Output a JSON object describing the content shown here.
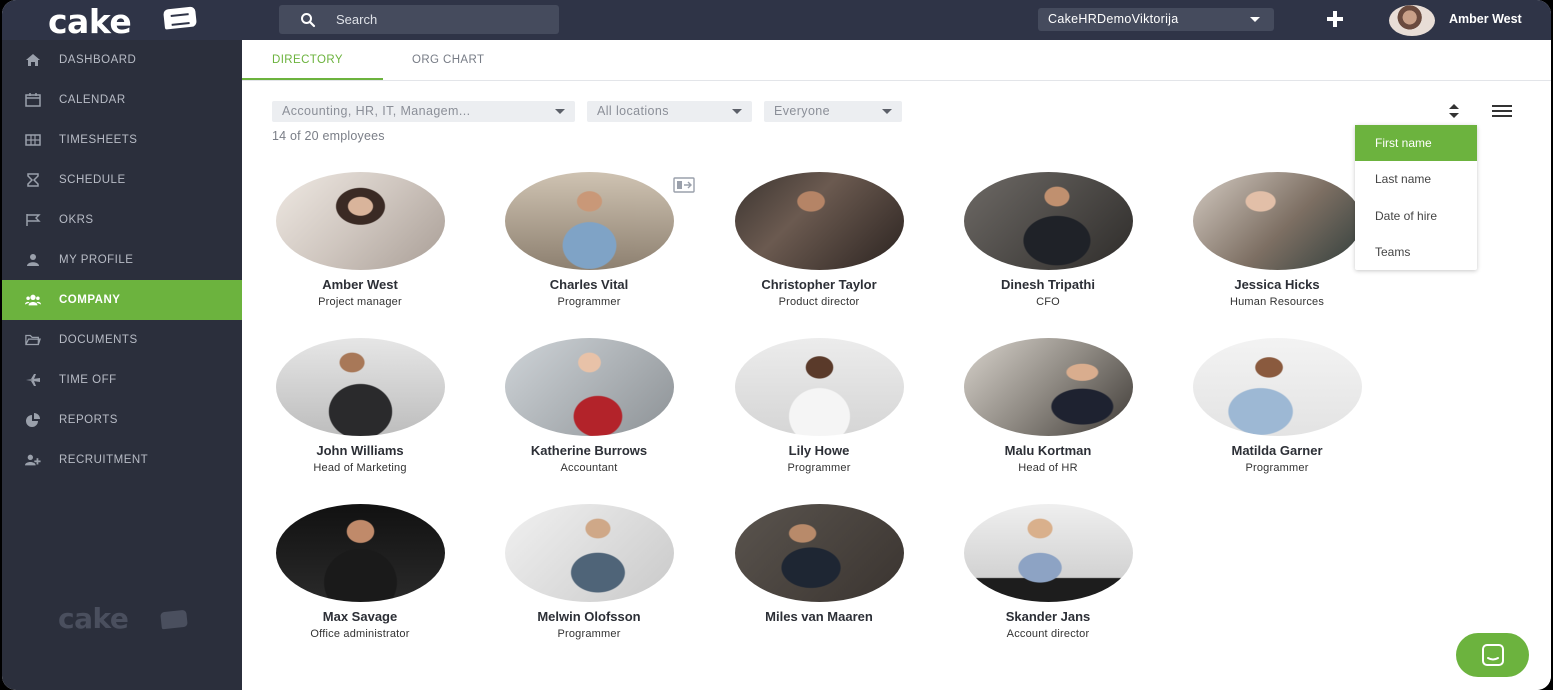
{
  "app": {
    "logo_text": "cake"
  },
  "topbar": {
    "search_placeholder": "Search",
    "company": "CakeHRDemoViktorija",
    "user_name": "Amber West"
  },
  "sidebar": {
    "items": [
      {
        "label": "DASHBOARD",
        "icon": "home-icon"
      },
      {
        "label": "CALENDAR",
        "icon": "calendar-icon"
      },
      {
        "label": "TIMESHEETS",
        "icon": "table-icon"
      },
      {
        "label": "SCHEDULE",
        "icon": "hourglass-icon"
      },
      {
        "label": "OKRS",
        "icon": "flag-icon"
      },
      {
        "label": "MY PROFILE",
        "icon": "user-icon"
      },
      {
        "label": "COMPANY",
        "icon": "users-icon",
        "active": true
      },
      {
        "label": "DOCUMENTS",
        "icon": "folder-icon"
      },
      {
        "label": "TIME OFF",
        "icon": "plane-icon"
      },
      {
        "label": "REPORTS",
        "icon": "pie-chart-icon"
      },
      {
        "label": "RECRUITMENT",
        "icon": "user-plus-icon"
      }
    ],
    "footer_logo": "cake"
  },
  "tabs": [
    {
      "label": "DIRECTORY",
      "active": true
    },
    {
      "label": "ORG CHART",
      "active": false
    }
  ],
  "filters": {
    "departments": "Accounting, HR, IT, Managem...",
    "locations": "All locations",
    "people": "Everyone"
  },
  "employee_count": "14 of 20 employees",
  "sort_menu": {
    "options": [
      "First name",
      "Last name",
      "Date of hire",
      "Teams"
    ],
    "selected": "First name"
  },
  "employees": [
    {
      "name": "Amber West",
      "title": "Project manager"
    },
    {
      "name": "Charles Vital",
      "title": "Programmer"
    },
    {
      "name": "Christopher Taylor",
      "title": "Product director"
    },
    {
      "name": "Dinesh Tripathi",
      "title": "CFO"
    },
    {
      "name": "Jessica Hicks",
      "title": "Human Resources"
    },
    {
      "name": "John Williams",
      "title": "Head of Marketing"
    },
    {
      "name": "Katherine Burrows",
      "title": "Accountant"
    },
    {
      "name": "Lily Howe",
      "title": "Programmer"
    },
    {
      "name": "Malu Kortman",
      "title": "Head of HR"
    },
    {
      "name": "Matilda Garner",
      "title": "Programmer"
    },
    {
      "name": "Max Savage",
      "title": "Office administrator"
    },
    {
      "name": "Melwin Olofsson",
      "title": "Programmer"
    },
    {
      "name": "Miles van Maaren",
      "title": ""
    },
    {
      "name": "Skander Jans",
      "title": "Account director"
    }
  ],
  "colors": {
    "accent": "#6cb33e",
    "topbar": "#2f3447",
    "sidebar": "#2b2f3c"
  }
}
